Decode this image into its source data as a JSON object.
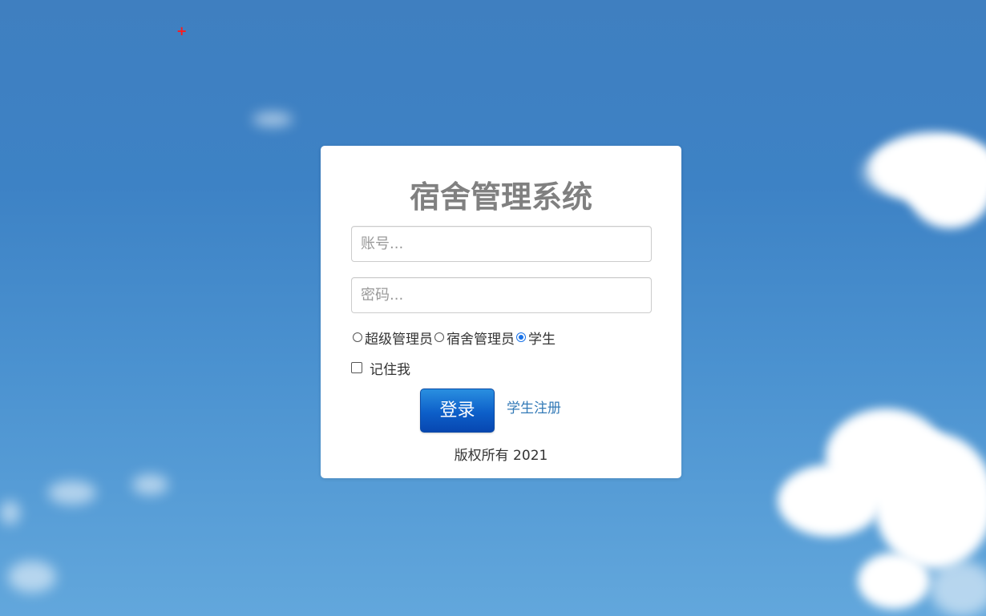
{
  "page": {
    "title": "宿舍管理系统"
  },
  "form": {
    "account_placeholder": "账号...",
    "password_placeholder": "密码...",
    "roles": [
      {
        "label": "超级管理员",
        "checked": false
      },
      {
        "label": "宿舍管理员",
        "checked": false
      },
      {
        "label": "学生",
        "checked": true
      }
    ],
    "remember_label": "记住我",
    "login_label": "登录",
    "register_label": "学生注册"
  },
  "footer": {
    "copyright": "版权所有 2021"
  },
  "colors": {
    "title": "#808080",
    "button": "#0d5fc9",
    "link": "#337ab7",
    "radio_selected": "#1a73e8"
  }
}
